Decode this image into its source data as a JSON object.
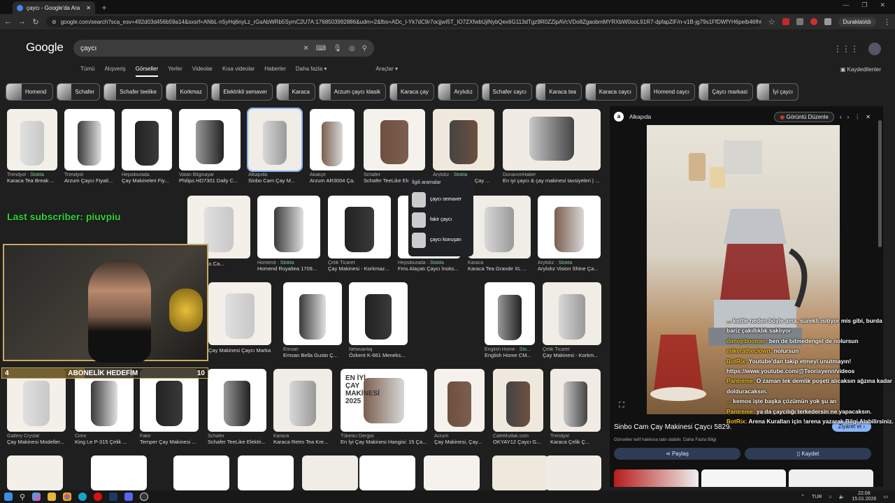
{
  "browser": {
    "tab_title": "çaycı - Google'da Ara",
    "url": "google.com/search?sca_esv=492d03d456b59a14&sxsrf=ANbL-n5yHq6nyLz_rGsAbWRb5SymC2U7A:1768503992886&udm=2&fbs=ADc_l-Yk7dC9r7ocjjwI5T_IO7ZXfwbUjiNybQex6G113dTgz9R0ZZipAVcVDo8ZgaobmMYRXbW0ooL91R7-dpfapZiF/n-v1B-jg79s1FfDWfYH6peib46fhQIu8VgCPez2Lppbn_3UR-wo-eKc-oTc1SkRRTUGbrre-l",
    "paused_label": "Duraklatıldı"
  },
  "google": {
    "logo": "Google",
    "query": "çaycı",
    "saved_label": "Kaydedilenler",
    "tools_label": "Araçlar ▾"
  },
  "filters": [
    "Tümü",
    "Alışveriş",
    "Görseller",
    "Yerler",
    "Videolar",
    "Kısa videolar",
    "Haberler",
    "Daha fazla ▾"
  ],
  "chips": [
    "Homend",
    "Schafer",
    "Schafer teelike",
    "Korkmaz",
    "Elektrikli semaver",
    "Karaca",
    "Arzum çaycı klasik",
    "Karaca çay",
    "Arylıdız",
    "Schafer caycı",
    "Karaca tea",
    "Karaca caycı",
    "Homend caycı",
    "Çaycı markasi",
    "İyi çaycı"
  ],
  "row1": [
    {
      "src": "Trendyol",
      "stock": "Stokta",
      "cap": "Karaca Tea Break ..."
    },
    {
      "src": "Trendyol",
      "stock": "",
      "cap": "Arzum Çaycı Fiyatl..."
    },
    {
      "src": "Hepsiburada",
      "stock": "",
      "cap": "Çay Makineleri Fiy..."
    },
    {
      "src": "Vatan Bilgisayar",
      "stock": "",
      "cap": "Philips HD7301 Daily C..."
    },
    {
      "src": "Alkapıda",
      "stock": "",
      "cap": "Sinbo Cam Çay M..."
    },
    {
      "src": "Akakçe",
      "stock": "",
      "cap": "Arzum AR3004 Ça..."
    },
    {
      "src": "Schafer",
      "stock": "",
      "cap": "Schafer TeeLike Elektrik..."
    },
    {
      "src": "Arylıdız",
      "stock": "Stokta",
      "cap": "Arylıdız Tea Style Çay ..."
    },
    {
      "src": "DonanımHaber",
      "stock": "",
      "cap": "En iyi çaycı & çay makinesi tavsiyeleri | ..."
    }
  ],
  "row2": [
    {
      "src": "",
      "stock": "",
      "cap": "Çay Glass Ca..."
    },
    {
      "src": "Homend",
      "stock": "Stokta",
      "cap": "Homend Royaltea 1709..."
    },
    {
      "src": "Çelik Ticaret",
      "stock": "",
      "cap": "Çay Makinesi - Korkmaz..."
    },
    {
      "src": "Hepsiburada",
      "stock": "Stokta",
      "cap": "Fms Alaçatı Çaycı İnoks..."
    },
    {
      "src": "Karaca",
      "stock": "",
      "cap": "Karaca Tea Grande XL ..."
    },
    {
      "src": "Arylıdız",
      "stock": "Stokta",
      "cap": "Arylıdız Vision Shine Ça..."
    }
  ],
  "row3": [
    {
      "src": "",
      "stock": "",
      "cap": "Çay Makinesi Çaycı Marka..."
    },
    {
      "src": "Emsan",
      "stock": "",
      "cap": "Emsan Bella Gusto Ç..."
    },
    {
      "src": "Netavantaj",
      "stock": "",
      "cap": "Özkent K-661 Meneks..."
    },
    {
      "src": "English Home",
      "stock": "Sto...",
      "cap": "English Home CM..."
    },
    {
      "src": "Çelik Ticaret",
      "stock": "",
      "cap": "Çay Makinesi - Korkm..."
    }
  ],
  "row4": [
    {
      "src": "Gallery Crystal",
      "stock": "",
      "cap": "Çay Makinesi Modeller..."
    },
    {
      "src": "Cimri",
      "stock": "",
      "cap": "King Le P-315 Çelik ..."
    },
    {
      "src": "Fakir",
      "stock": "",
      "cap": "Temper Çay Makinesi ..."
    },
    {
      "src": "Schafer",
      "stock": "",
      "cap": "Schafer TeeLike Elektri..."
    },
    {
      "src": "Karaca",
      "stock": "",
      "cap": "Karaca Retro Tea Kre..."
    },
    {
      "src": "Tüketici Dergisi",
      "stock": "",
      "cap": "En İyi Çay Makinesi Hangisi: 15 Ça..."
    },
    {
      "src": "Arzum",
      "stock": "",
      "cap": "Çay Makinesi, Çay..."
    },
    {
      "src": "CafeMutfak.com",
      "stock": "",
      "cap": "OKYAY12 Çaycı G..."
    },
    {
      "src": "Trendyol",
      "stock": "",
      "cap": "Karaca Çelik Ç..."
    }
  ],
  "promo_text": "EN İYİ ÇAY MAKİNESİ 2025",
  "related": {
    "title": "İlgili aramalar",
    "items": [
      "çaycı semaver",
      "fakir çaycı",
      "çaycı konuşan"
    ]
  },
  "panel": {
    "site": "Alkapıda",
    "lens_label": "Görüntü Düzenle",
    "title": "Sinbo Cam Çay Makinesi Çaycı 5829.",
    "visit": "Ziyaret et",
    "note": "Görseller telif hakkına tabi olabilir. Daha Fazla Bilgi",
    "share": "Paylaş",
    "save": "Kaydet"
  },
  "overlay": {
    "subscriber": "Last subscriber: piuvpiu",
    "goal_left": "4",
    "goal_label": "ABONELİK HEDEFİM",
    "goal_right": "10",
    "goal_fraction": 0.4
  },
  "chat": [
    {
      "user": "...",
      "msg": "kettle neden böyle ama, sürekli ısıtıyor mis gibi, burda bariz çakıllıklık saklıyor"
    },
    {
      "user": "dimojrboomer:",
      "msg": "ben de bitmedengel de nolursun"
    },
    {
      "user": "mikeratheclown:",
      "msg": "nolursun"
    },
    {
      "user": "BotRix:",
      "msg": "Youtube'dan takip etmeyi unutmayın! https://www.youtube.com/@Teorisyenn/videos"
    },
    {
      "user": "Pantreme:",
      "msg": "O zaman tek demlik poşeti alıcaksın ağzına kadar dolduracaksın."
    },
    {
      "user": "...",
      "msg": "kemos işte başka çözümün yok şu an"
    },
    {
      "user": "Pantreme:",
      "msg": "ya da çaycılığı terkedersin ne yapacaksın."
    },
    {
      "user": "BotRix:",
      "msg": "Arena Kuralları için !arena yazarak Bilgi Alabilirsiniz."
    }
  ],
  "taskbar": {
    "lang": "TUR",
    "time": "22:08",
    "date": "15.01.2026"
  }
}
